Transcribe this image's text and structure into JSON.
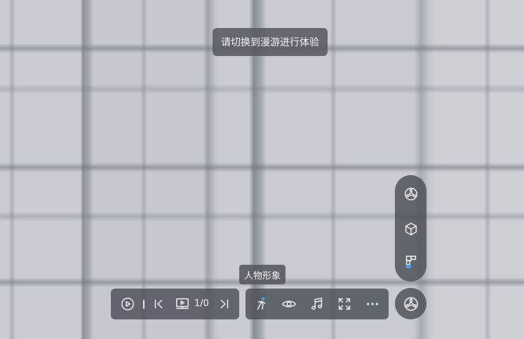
{
  "toast": {
    "text": "请切换到漫游进行体验"
  },
  "tooltip": {
    "text": "人物形象"
  },
  "player": {
    "page_count": "1/0",
    "icons": [
      "play-icon",
      "separator",
      "previous-icon",
      "slideshow-icon",
      "next-icon"
    ]
  },
  "toolbar": {
    "icons": [
      "figure-icon",
      "eye-icon",
      "music-icon",
      "fullscreen-icon",
      "more-icon"
    ]
  },
  "view_modes": {
    "icons": [
      "panorama-icon",
      "model-3d-icon",
      "floorplan-icon"
    ]
  },
  "mode_toggle": {
    "icon": "panorama-icon"
  },
  "colors": {
    "panel": "#4a4e55",
    "accent": "#4a9fff",
    "text": "#f0f1f3"
  }
}
